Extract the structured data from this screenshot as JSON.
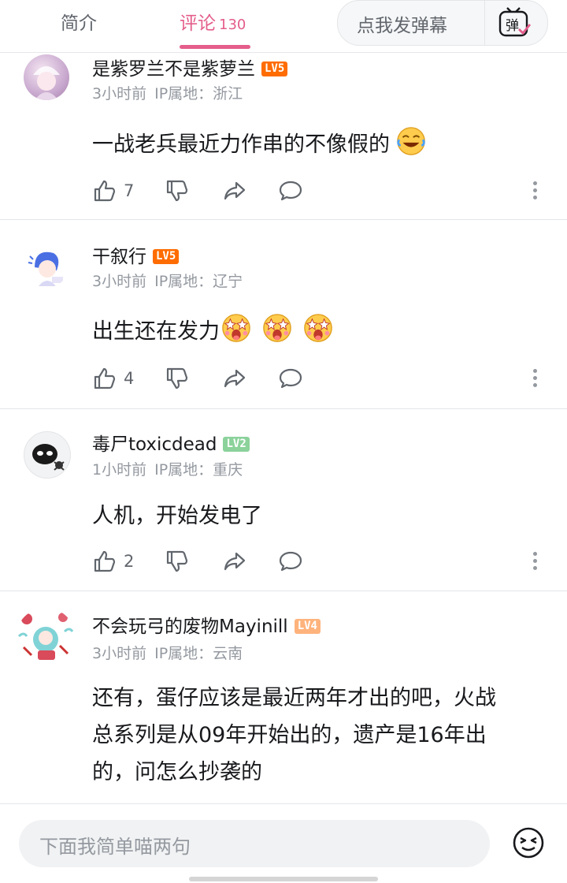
{
  "tabs": {
    "intro": "简介",
    "comments": "评论",
    "comment_count": "130"
  },
  "danmaku": {
    "placeholder": "点我发弹幕",
    "toggle_label": "弹"
  },
  "comments": [
    {
      "username": "是紫罗兰不是紫萝兰",
      "level": "LV5",
      "time": "3小时前",
      "ip": "IP属地：浙江",
      "text": "一战老兵最近力作串的不像假的",
      "likes": "7"
    },
    {
      "username": "干叙行",
      "level": "LV5",
      "time": "3小时前",
      "ip": "IP属地：辽宁",
      "text": "出生还在发力",
      "likes": "4"
    },
    {
      "username": "毒尸toxicdead",
      "level": "LV2",
      "time": "1小时前",
      "ip": "IP属地：重庆",
      "text": "人机，开始发电了",
      "likes": "2"
    },
    {
      "username": "不会玩弓的废物Mayinill",
      "level": "LV4",
      "time": "3小时前",
      "ip": "IP属地：云南",
      "text_lines": [
        "还有，蛋仔应该是最近两年才出的吧，火战",
        "总系列是从09年开始出的，遗产是16年出",
        "的，问怎么抄袭的"
      ]
    }
  ],
  "reply": {
    "placeholder": "下面我简单喵两句"
  },
  "icons": [
    "like-icon",
    "dislike-icon",
    "share-icon",
    "reply-icon",
    "more-icon",
    "emoji-icon"
  ],
  "colors": {
    "accent": "#e45d8b",
    "lv5": "#ff6c00",
    "lv2": "#8bd29b",
    "lv4": "#ffb37c"
  }
}
